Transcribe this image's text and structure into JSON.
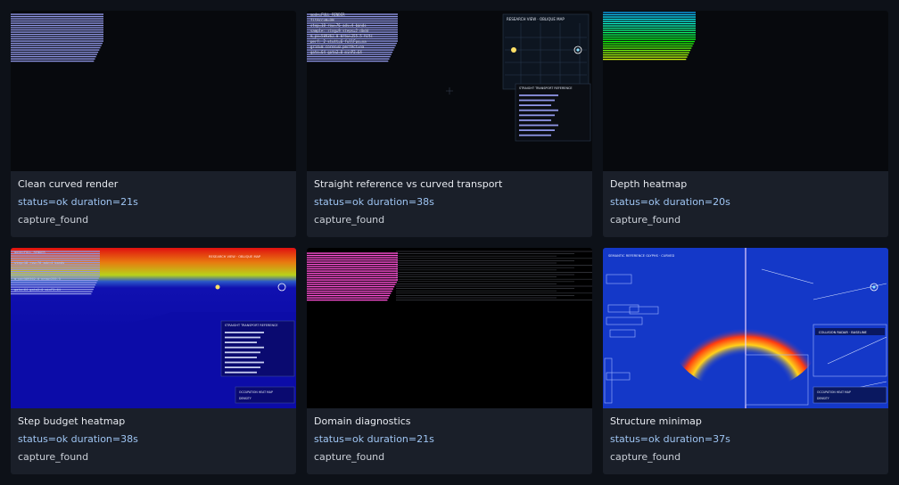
{
  "cards": [
    {
      "title": "Clean curved render",
      "status": "status=ok duration=21s",
      "capture": "capture_found",
      "thumb_icon": "curved-render-thumbnail"
    },
    {
      "title": "Straight reference vs curved transport",
      "status": "status=ok duration=38s",
      "capture": "capture_found",
      "thumb_icon": "straight-vs-curved-thumbnail"
    },
    {
      "title": "Depth heatmap",
      "status": "status=ok duration=20s",
      "capture": "capture_found",
      "thumb_icon": "depth-heatmap-thumbnail"
    },
    {
      "title": "Step budget heatmap",
      "status": "status=ok duration=38s",
      "capture": "capture_found",
      "thumb_icon": "step-budget-thumbnail"
    },
    {
      "title": "Domain diagnostics",
      "status": "status=ok duration=21s",
      "capture": "capture_found",
      "thumb_icon": "domain-diagnostics-thumbnail"
    },
    {
      "title": "Structure minimap",
      "status": "status=ok duration=37s",
      "capture": "capture_found",
      "thumb_icon": "structure-minimap-thumbnail"
    }
  ],
  "overlay": {
    "mode": "mode=FULL_RENDER",
    "research_view": "RESEARCH VIEW · OBLIQUE MAP",
    "straight_ref": "STRAIGHT TRANSPORT REFERENCE",
    "semantic": "SEMANTIC REFERENCE GLYPHS · CURVED",
    "collision": "COLLISION RADAR · BASELINE",
    "occupation": "OCCUPATION HEAT MAP",
    "density": "DENSITY"
  },
  "colors": {
    "page_bg": "#0d1118",
    "card_bg": "#1a1f29",
    "title": "#e6e9ef",
    "status": "#9ec4f2",
    "capture": "#c9ced6",
    "stripe_blue": "#8f96e6",
    "stripe_magenta": "#ff4fd8"
  }
}
